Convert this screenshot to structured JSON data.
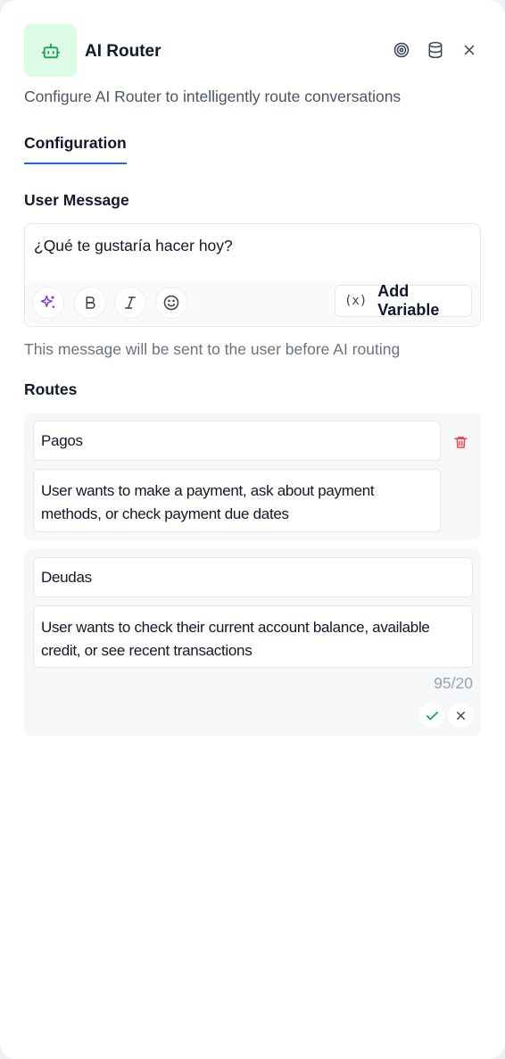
{
  "header": {
    "title": "AI Router",
    "icons": [
      "bot-icon",
      "target-icon",
      "database-icon",
      "close-icon"
    ],
    "subtitle": "Configure AI Router to intelligently route conversations"
  },
  "tabs": [
    {
      "label": "Configuration",
      "active": true
    }
  ],
  "user_message": {
    "label": "User Message",
    "text": "¿Qué te gustaría hacer hoy?",
    "toolbar": {
      "icons": [
        "sparkles-icon",
        "bold-icon",
        "italic-icon",
        "emoji-icon"
      ],
      "add_variable_icon": "(x)",
      "add_variable_label": "Add Variable"
    },
    "helper": "This message will be sent to the user before AI routing"
  },
  "routes": {
    "label": "Routes",
    "items": [
      {
        "name": "Pagos",
        "description": "User wants to make a payment, ask about payment methods, or check payment due dates"
      },
      {
        "name": "Deudas",
        "description": "User wants to check their current account balance, available credit, or see recent transactions",
        "counter": "95/20"
      }
    ]
  },
  "colors": {
    "accent": "#2563eb",
    "avatar_bg": "#dcfce7",
    "bot_icon": "#16a34a",
    "delete": "#ef4444",
    "confirm": "#16a34a",
    "ai_sparkle": "#7c3aed"
  }
}
